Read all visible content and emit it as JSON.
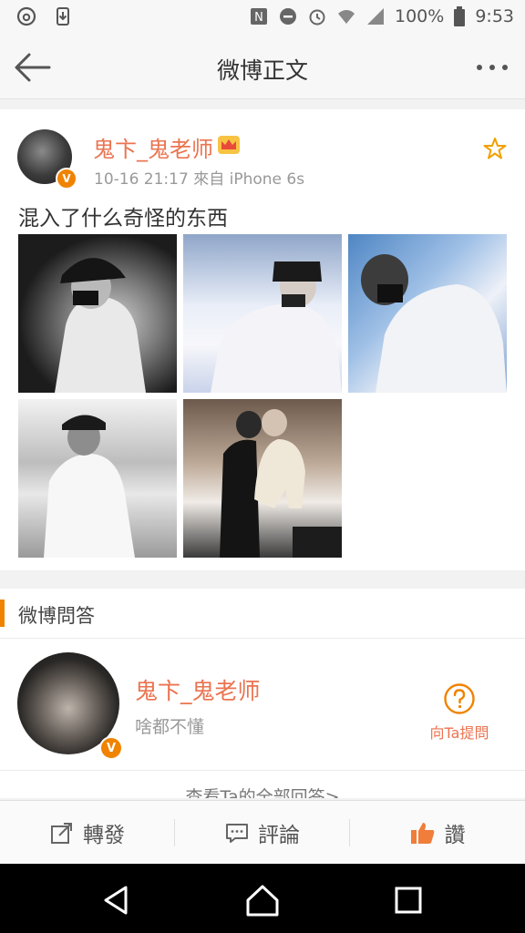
{
  "status_bar": {
    "battery": "100%",
    "time": "9:53",
    "icons": [
      "netease-music-icon",
      "download-icon",
      "nfc-icon",
      "dnd-icon",
      "alarm-icon",
      "wifi-icon",
      "signal-icon",
      "battery-icon"
    ]
  },
  "nav": {
    "title": "微博正文",
    "back_icon": "arrow-left-icon",
    "more_icon": "more-dots-icon"
  },
  "post": {
    "author": "鬼卞_鬼老师",
    "verified_badge": "V",
    "vip_icon": "crown-icon",
    "meta": "10-16 21:17  來自 iPhone 6s",
    "text": "混入了什么奇怪的东西",
    "favorite_icon": "star-icon",
    "photos": [
      "photo-1",
      "photo-2",
      "photo-3",
      "photo-4",
      "photo-5"
    ]
  },
  "qa": {
    "section_title": "微博問答",
    "name": "鬼卞_鬼老师",
    "desc": "啥都不懂",
    "ask_label": "向Ta提問",
    "more_link": "查看Ta的全部回答>"
  },
  "toolbar": {
    "repost": "轉發",
    "comment": "評論",
    "like": "讚"
  },
  "colors": {
    "accent": "#eb7350",
    "badge": "#f08300",
    "background": "#f2f2f2"
  }
}
